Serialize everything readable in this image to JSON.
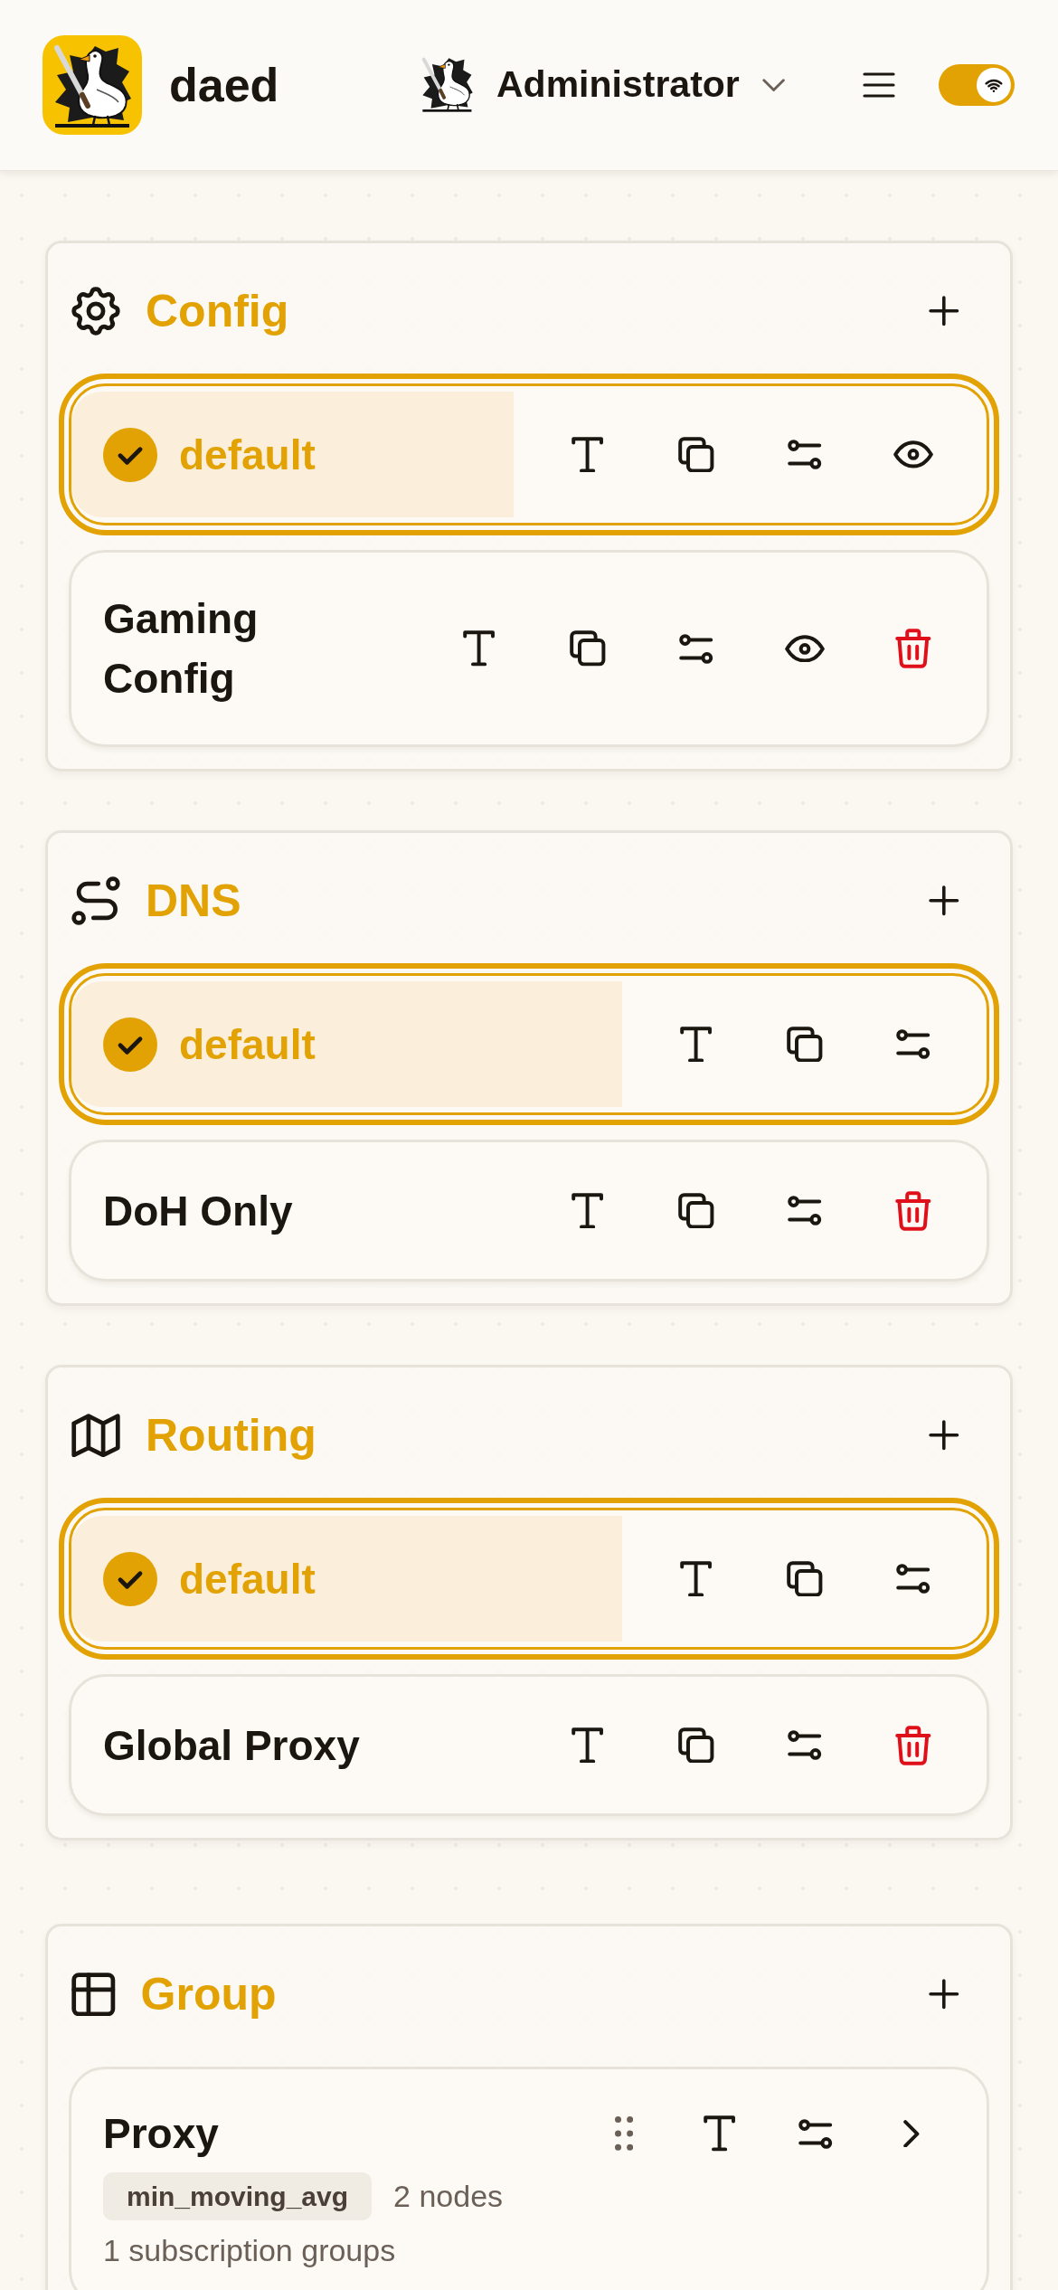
{
  "header": {
    "app_name": "daed",
    "user": "Administrator",
    "switch": {
      "on": true
    }
  },
  "sections": [
    {
      "kind": "config",
      "title": "Config",
      "items": [
        {
          "name": "default",
          "selected": true,
          "actions": [
            {
              "kind": "rename"
            },
            {
              "kind": "duplicate"
            },
            {
              "kind": "settings"
            },
            {
              "kind": "view"
            }
          ]
        },
        {
          "name": "Gaming Config",
          "selected": false,
          "actions": [
            {
              "kind": "rename"
            },
            {
              "kind": "duplicate"
            },
            {
              "kind": "settings"
            },
            {
              "kind": "view"
            },
            {
              "kind": "delete"
            }
          ]
        }
      ]
    },
    {
      "kind": "dns",
      "title": "DNS",
      "items": [
        {
          "name": "default",
          "selected": true,
          "actions": [
            {
              "kind": "rename"
            },
            {
              "kind": "duplicate"
            },
            {
              "kind": "settings"
            }
          ]
        },
        {
          "name": "DoH Only",
          "selected": false,
          "actions": [
            {
              "kind": "rename"
            },
            {
              "kind": "duplicate"
            },
            {
              "kind": "settings"
            },
            {
              "kind": "delete"
            }
          ]
        }
      ]
    },
    {
      "kind": "routing",
      "title": "Routing",
      "items": [
        {
          "name": "default",
          "selected": true,
          "actions": [
            {
              "kind": "rename"
            },
            {
              "kind": "duplicate"
            },
            {
              "kind": "settings"
            }
          ]
        },
        {
          "name": "Global Proxy",
          "selected": false,
          "actions": [
            {
              "kind": "rename"
            },
            {
              "kind": "duplicate"
            },
            {
              "kind": "settings"
            },
            {
              "kind": "delete"
            }
          ]
        }
      ]
    },
    {
      "kind": "group",
      "title": "Group",
      "items": [
        {
          "name": "Proxy",
          "policy": "min_moving_avg",
          "nodes": "2 nodes",
          "subscriptions": "1 subscription groups",
          "actions": [
            {
              "kind": "drag"
            },
            {
              "kind": "rename"
            },
            {
              "kind": "settings"
            },
            {
              "kind": "open"
            }
          ]
        }
      ]
    }
  ]
}
